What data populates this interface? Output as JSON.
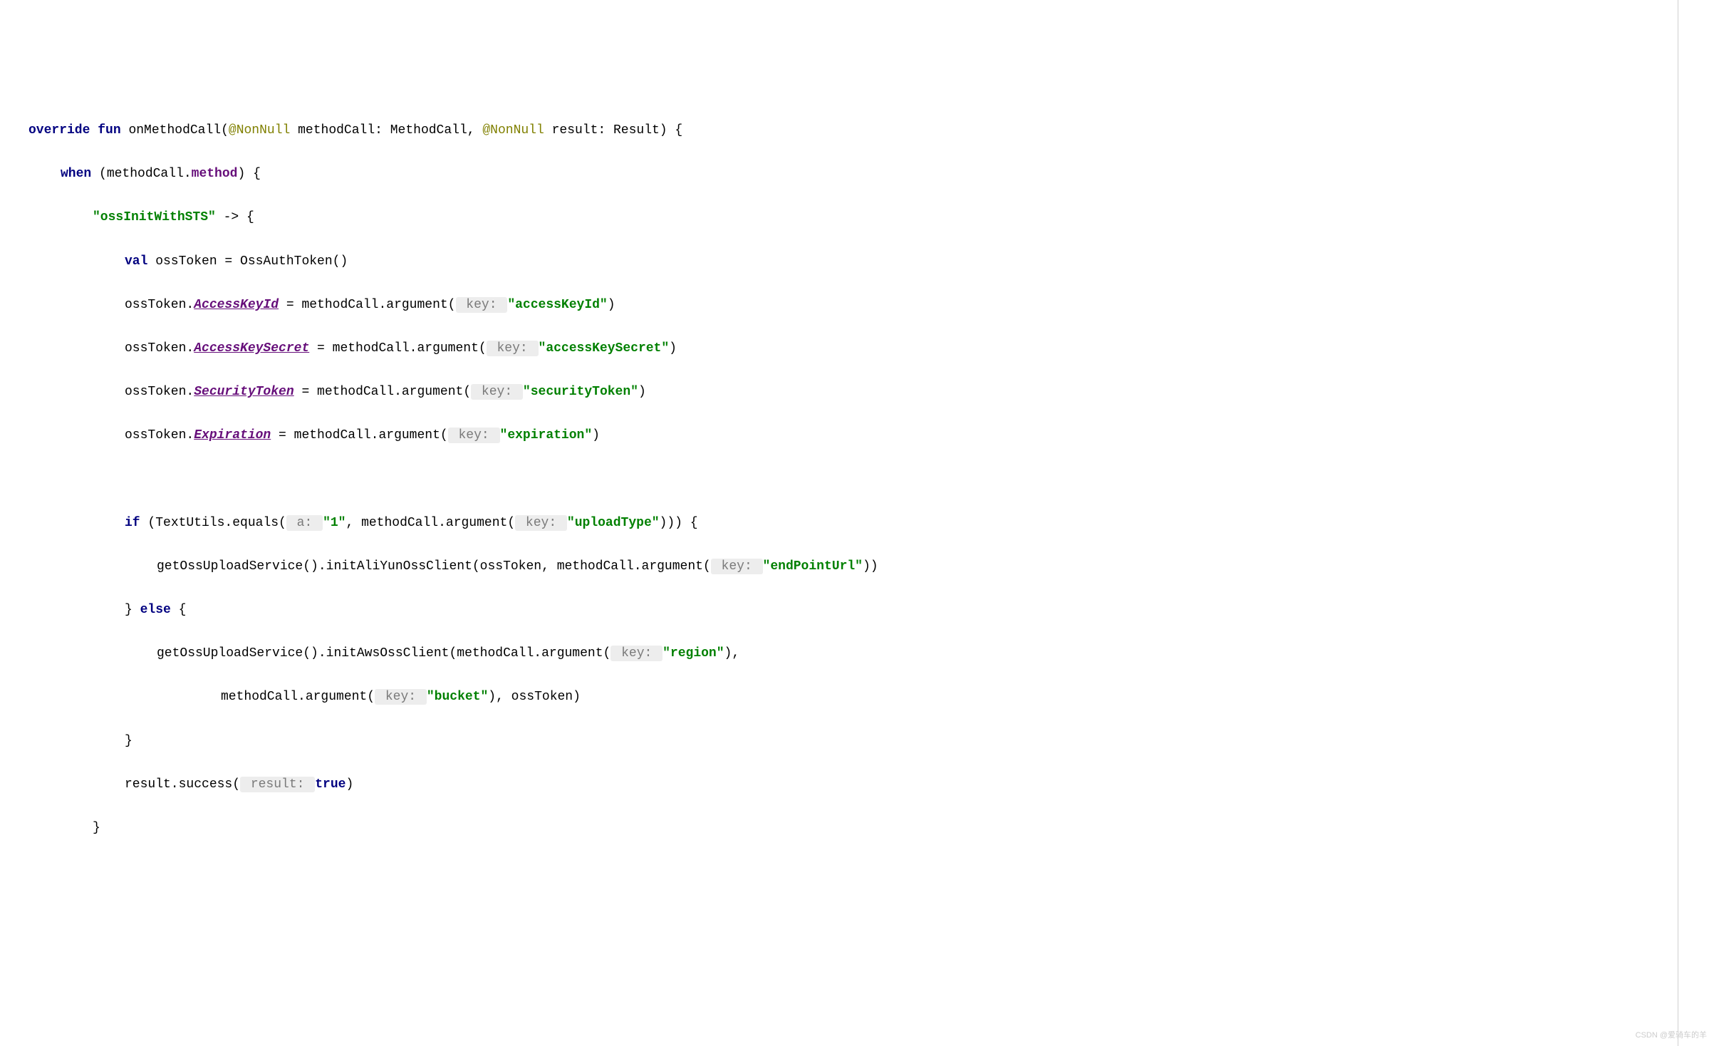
{
  "code": {
    "line1": {
      "override": "override",
      "fun": "fun",
      "method_name": "onMethodCall",
      "anno1": "@NonNull",
      "p1": " methodCall: MethodCall, ",
      "anno2": "@NonNull",
      "p2": " result: Result) {"
    },
    "line2": {
      "when": "when",
      "rest": " (methodCall.",
      "method": "method",
      "close": ") {"
    },
    "line3": {
      "str": "\"ossInitWithSTS\"",
      "arrow": " -> {"
    },
    "line4": {
      "val": "val",
      "rest": " ossToken = OssAuthToken()"
    },
    "line5": {
      "pre": "ossToken.",
      "prop": "AccessKeyId",
      "mid": " = methodCall.argument(",
      "hint": " key: ",
      "str": "\"accessKeyId\"",
      "close": ")"
    },
    "line6": {
      "pre": "ossToken.",
      "prop": "AccessKeySecret",
      "mid": " = methodCall.argument(",
      "hint": " key: ",
      "str": "\"accessKeySecret\"",
      "close": ")"
    },
    "line7": {
      "pre": "ossToken.",
      "prop": "SecurityToken",
      "mid": " = methodCall.argument(",
      "hint": " key: ",
      "str": "\"securityToken\"",
      "close": ")"
    },
    "line8": {
      "pre": "ossToken.",
      "prop": "Expiration",
      "mid": " = methodCall.argument(",
      "hint": " key: ",
      "str": "\"expiration\"",
      "close": ")"
    },
    "line10": {
      "if": "if",
      "pre": " (TextUtils.equals(",
      "hint1": " a: ",
      "str1": "\"1\"",
      "mid": ", methodCall.argument(",
      "hint2": " key: ",
      "str2": "\"uploadType\"",
      "close": "))) {"
    },
    "line11": {
      "pre": "getOssUploadService().initAliYunOssClient(ossToken, methodCall.argument(",
      "hint": " key: ",
      "str": "\"endPointUrl\"",
      "close": "))"
    },
    "line12": {
      "brace": "} ",
      "else": "else",
      "open": " {"
    },
    "line13": {
      "pre": "getOssUploadService().initAwsOssClient(methodCall.argument(",
      "hint": " key: ",
      "str": "\"region\"",
      "close": "),"
    },
    "line14": {
      "pre": "methodCall.argument(",
      "hint": " key: ",
      "str": "\"bucket\"",
      "close": "), ossToken)"
    },
    "line15": {
      "brace": "}"
    },
    "line16": {
      "pre": "result.success(",
      "hint": " result: ",
      "bool": "true",
      "close": ")"
    },
    "line17": {
      "brace": "}"
    }
  },
  "watermark": "CSDN @爱骑车的羊"
}
